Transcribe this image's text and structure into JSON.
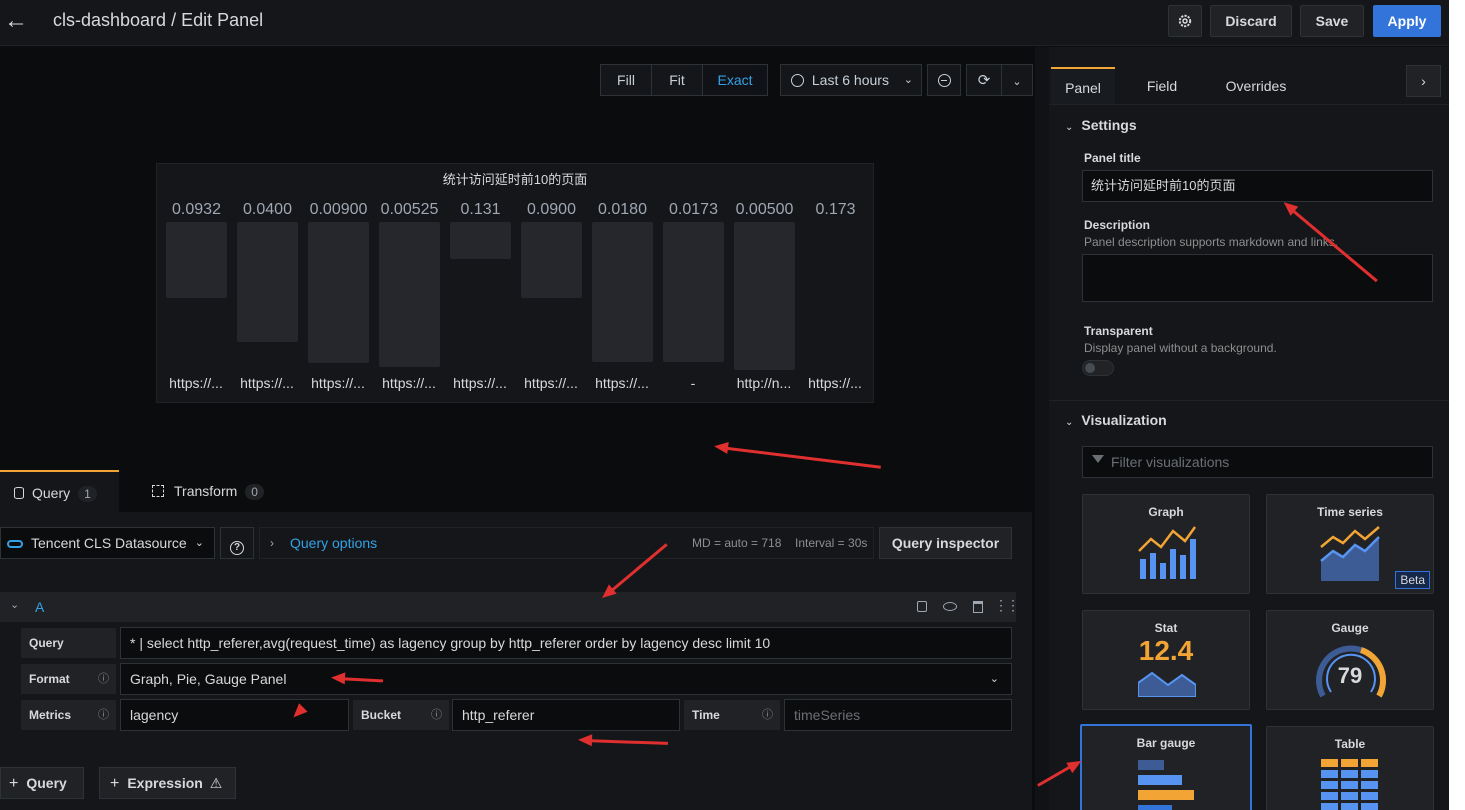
{
  "header": {
    "title": "cls-dashboard / Edit Panel",
    "discard": "Discard",
    "save": "Save",
    "apply": "Apply"
  },
  "toolbar": {
    "fill": "Fill",
    "fit": "Fit",
    "exact": "Exact",
    "timerange": "Last 6 hours"
  },
  "panel": {
    "title": "统计访问延时前10的页面",
    "bars": [
      {
        "value": "0.0932",
        "label": "https://...",
        "level": 0.54
      },
      {
        "value": "0.0400",
        "label": "https://...",
        "level": 0.85
      },
      {
        "value": "0.00900",
        "label": "https://...",
        "level": 1.0
      },
      {
        "value": "0.00525",
        "label": "https://...",
        "level": 1.03
      },
      {
        "value": "0.131",
        "label": "https://...",
        "level": 0.26
      },
      {
        "value": "0.0900",
        "label": "https://...",
        "level": 0.54
      },
      {
        "value": "0.0180",
        "label": "https://...",
        "level": 0.99
      },
      {
        "value": "0.0173",
        "label": "-",
        "level": 0.99
      },
      {
        "value": "0.00500",
        "label": "http://n...",
        "level": 1.05
      },
      {
        "value": "0.173",
        "label": "https://...",
        "level": 0.0
      }
    ]
  },
  "query_tabs": {
    "query_label": "Query",
    "query_count": "1",
    "transform_label": "Transform",
    "transform_count": "0"
  },
  "query_bar": {
    "datasource": "Tencent CLS Datasource",
    "options": "Query options",
    "md": "MD = auto = 718",
    "interval": "Interval = 30s",
    "inspector": "Query inspector"
  },
  "query_row": {
    "ref": "A",
    "query_label": "Query",
    "query_value": "* | select http_referer,avg(request_time) as lagency group by http_referer order by lagency desc limit 10",
    "format_label": "Format",
    "format_value": "Graph, Pie, Gauge Panel",
    "metrics_label": "Metrics",
    "metrics_value": "lagency",
    "bucket_label": "Bucket",
    "bucket_value": "http_referer",
    "time_label": "Time",
    "time_placeholder": "timeSeries"
  },
  "bottom": {
    "add_query": "Query",
    "add_expression": "Expression"
  },
  "options": {
    "tabs": [
      "Panel",
      "Field",
      "Overrides"
    ],
    "settings": "Settings",
    "panel_title_label": "Panel title",
    "panel_title_value": "统计访问延时前10的页面",
    "description_label": "Description",
    "description_hint": "Panel description supports markdown and links.",
    "transparent_label": "Transparent",
    "transparent_hint": "Display panel without a background.",
    "visualization": "Visualization",
    "filter_placeholder": "Filter visualizations",
    "cards": {
      "graph": "Graph",
      "timeseries": "Time series",
      "beta": "Beta",
      "stat": "Stat",
      "stat_value": "12.4",
      "gauge": "Gauge",
      "gauge_value": "79",
      "bargauge": "Bar gauge",
      "table": "Table"
    }
  },
  "colors": {
    "accent": "#3274d9",
    "tab_active": "#f2a434",
    "annotation": "#e02f2f"
  }
}
